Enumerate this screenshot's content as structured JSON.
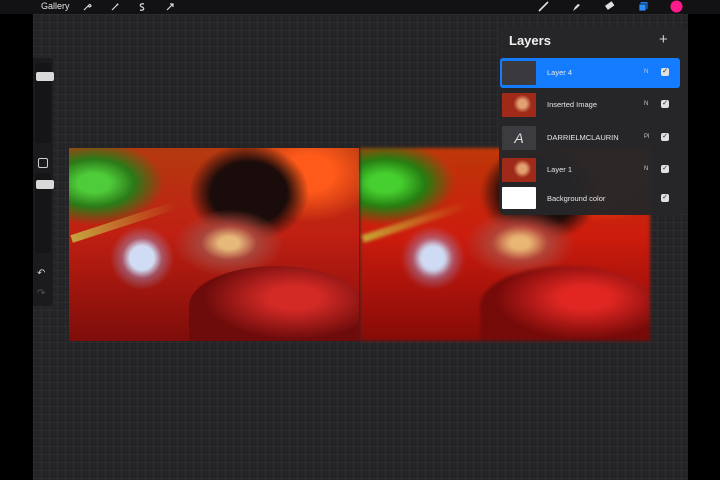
{
  "topbar": {
    "gallery_label": "Gallery",
    "left_tools": [
      {
        "name": "actions-icon",
        "glyph": "🔧"
      },
      {
        "name": "adjustments-icon",
        "glyph": "✦"
      },
      {
        "name": "selection-icon",
        "glyph": "S"
      },
      {
        "name": "transform-icon",
        "glyph": "➤"
      }
    ],
    "right_tools": [
      {
        "name": "brush-icon"
      },
      {
        "name": "smudge-icon"
      },
      {
        "name": "eraser-icon"
      },
      {
        "name": "layers-icon"
      },
      {
        "name": "color-picker-swatch",
        "color": "#ff1a8c"
      }
    ]
  },
  "sidebar": {
    "undo_glyph": "↶",
    "redo_glyph": "↷"
  },
  "layers_panel": {
    "title": "Layers",
    "add_glyph": "+",
    "layers": [
      {
        "name": "Layer 4",
        "blend": "N",
        "visible": true,
        "selected": true,
        "thumb": "dark"
      },
      {
        "name": "Inserted Image",
        "blend": "N",
        "visible": true,
        "selected": false,
        "thumb": "photo"
      },
      {
        "name": "DARRIELMCLAURIN",
        "blend": "Pl",
        "visible": true,
        "selected": false,
        "thumb": "text",
        "thumb_glyph": "A"
      },
      {
        "name": "Layer 1",
        "blend": "N",
        "visible": true,
        "selected": false,
        "thumb": "photo"
      },
      {
        "name": "Background color",
        "blend": "",
        "visible": true,
        "selected": false,
        "thumb": "white"
      }
    ]
  },
  "colors": {
    "accent": "#147dff",
    "color_swatch": "#ff1a8c",
    "canvas_bg": "#242426"
  }
}
